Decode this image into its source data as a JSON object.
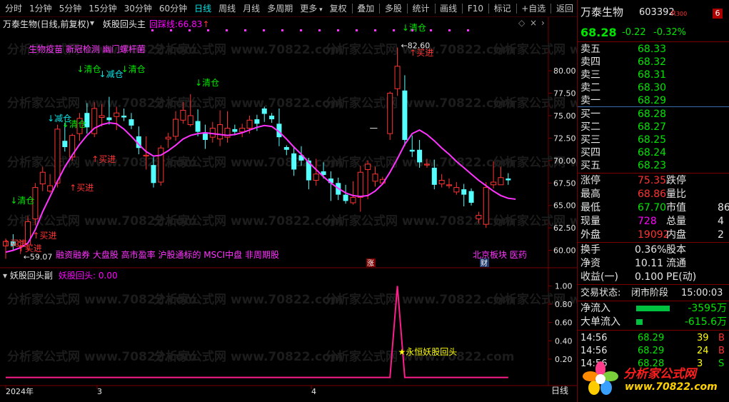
{
  "toolbar": {
    "left": [
      "分时",
      "1分钟",
      "5分钟",
      "15分钟",
      "30分钟",
      "60分钟",
      "日线",
      "周线",
      "月线",
      "多周期",
      "更多"
    ],
    "active": "日线",
    "right": [
      "复权",
      "叠加",
      "多股",
      "统计",
      "画线",
      "F10",
      "标记",
      "+自选",
      "返回"
    ]
  },
  "main_panel": {
    "title": "万泰生物(日线,前复权)",
    "formula": "妖股回头主",
    "indicator_label": "回踩线:",
    "indicator_value": "66.83",
    "indicator_arrow": "↑",
    "watermark": "分析家公式网 www.70822.com",
    "concepts_top": "生物疫苗 新冠检测 幽门螺杆菌",
    "concepts_bottom": "融资融券 大盘股 高市盈率 沪股通标的 MSCI中盘 非周期股",
    "concepts_right": "北京板块 医药",
    "price_low_label": "59.07",
    "price_high_label": "82.60",
    "zhang_badge": "涨",
    "cai_badge": "财",
    "signals": [
      {
        "text": "↓清仓",
        "color": "#00e600"
      },
      {
        "text": "↓减仓",
        "color": "#00e5e5"
      },
      {
        "text": "↓清仓",
        "color": "#00e600"
      },
      {
        "text": "↓减仓",
        "color": "#00e5e5"
      },
      {
        "text": "↓清仓",
        "color": "#00e600"
      },
      {
        "text": "↓清仓",
        "color": "#00e600"
      },
      {
        "text": "↓清仓",
        "color": "#00e600"
      },
      {
        "text": "↓清仓",
        "color": "#00e600"
      },
      {
        "text": "↑买进",
        "color": "#ff3232"
      },
      {
        "text": "↑买进",
        "color": "#ff3232"
      },
      {
        "text": "↑买进",
        "color": "#ff3232"
      },
      {
        "text": "↑买进",
        "color": "#ff3232"
      },
      {
        "text": "↑买进",
        "color": "#ff3232"
      },
      {
        "text": "↑买进",
        "color": "#ff3232"
      }
    ]
  },
  "sub_panel": {
    "title": "妖股回头副",
    "indicator_label": "妖股回头:",
    "indicator_value": "0.00",
    "annotation": "★永恒妖股回头"
  },
  "x_axis": {
    "labels": [
      "2024年",
      "3",
      "4"
    ],
    "period": "日线"
  },
  "chart_data": {
    "type": "candlestick",
    "main_y_ticks": [
      "80.00",
      "77.50",
      "75.00",
      "72.50",
      "70.00",
      "67.50",
      "65.00",
      "62.50",
      "60.00"
    ],
    "main_ylim": [
      58.3,
      84.7
    ],
    "sub_y_ticks": [
      "1.00",
      "0.80",
      "0.60",
      "0.40",
      "0.20"
    ],
    "sub_ylim": [
      -0.05,
      1.05
    ],
    "candles": [
      [
        60.5,
        61.3,
        59.07,
        61.0
      ],
      [
        61.0,
        61.8,
        60.0,
        60.5
      ],
      [
        60.5,
        61.2,
        59.6,
        61.0
      ],
      [
        60.6,
        63.8,
        60.0,
        63.2
      ],
      [
        63.5,
        67.5,
        62.8,
        67.0
      ],
      [
        67.4,
        69.3,
        66.6,
        68.7
      ],
      [
        66.6,
        68.5,
        66.4,
        67.2
      ],
      [
        67.5,
        74.0,
        67.0,
        73.5
      ],
      [
        72.2,
        74.2,
        71.0,
        71.5
      ],
      [
        70.4,
        73.0,
        70.0,
        72.8
      ],
      [
        73.0,
        75.3,
        72.2,
        74.7
      ],
      [
        75.3,
        76.4,
        73.0,
        73.7
      ],
      [
        73.0,
        76.5,
        72.6,
        75.8
      ],
      [
        74.8,
        76.3,
        73.8,
        75.0
      ],
      [
        74.8,
        77.1,
        74.0,
        74.5
      ],
      [
        74.9,
        76.0,
        73.4,
        75.3
      ],
      [
        75.0,
        75.8,
        74.4,
        74.8
      ],
      [
        74.6,
        75.3,
        73.5,
        73.9
      ],
      [
        72.7,
        73.8,
        70.7,
        71.4
      ],
      [
        70.5,
        72.7,
        69.0,
        70.6
      ],
      [
        69.5,
        70.4,
        67.0,
        67.5
      ],
      [
        67.6,
        71.7,
        67.2,
        71.4
      ],
      [
        72.4,
        73.1,
        71.4,
        72.6
      ],
      [
        72.7,
        75.5,
        72.2,
        74.6
      ],
      [
        74.5,
        76.5,
        74.1,
        75.6
      ],
      [
        74.0,
        77.4,
        73.8,
        75.0
      ],
      [
        74.4,
        75.7,
        72.7,
        73.2
      ],
      [
        73.0,
        74.0,
        71.3,
        72.3
      ],
      [
        72.6,
        74.3,
        72.0,
        73.6
      ],
      [
        72.4,
        75.6,
        71.6,
        74.0
      ],
      [
        72.6,
        75.5,
        72.0,
        73.6
      ],
      [
        73.5,
        74.0,
        72.8,
        73.2
      ],
      [
        73.2,
        74.1,
        72.6,
        73.6
      ],
      [
        73.6,
        75.0,
        73.0,
        74.5
      ],
      [
        74.6,
        75.1,
        73.3,
        74.1
      ],
      [
        75.8,
        76.0,
        74.3,
        75.2
      ],
      [
        75.0,
        75.3,
        74.2,
        74.6
      ],
      [
        74.1,
        75.8,
        71.6,
        72.6
      ],
      [
        71.5,
        71.7,
        70.6,
        71.2
      ],
      [
        70.8,
        71.6,
        68.3,
        69.0
      ],
      [
        70.6,
        71.6,
        69.4,
        70.0
      ],
      [
        70.0,
        70.3,
        66.8,
        67.8
      ],
      [
        67.8,
        70.2,
        67.2,
        68.5
      ],
      [
        68.8,
        69.8,
        68.0,
        68.4
      ],
      [
        68.0,
        68.8,
        65.5,
        67.5
      ],
      [
        67.5,
        68.1,
        65.6,
        66.2
      ],
      [
        66.2,
        67.3,
        65.2,
        65.5
      ],
      [
        65.3,
        67.7,
        65.1,
        65.9
      ],
      [
        65.9,
        69.4,
        64.3,
        68.7
      ],
      [
        69.0,
        70.0,
        65.7,
        69.6
      ],
      [
        67.7,
        69.3,
        67.1,
        68.5
      ],
      [
        67.5,
        68.2,
        67.3,
        67.9
      ],
      [
        73.0,
        77.7,
        72.3,
        77.5
      ],
      [
        78.0,
        82.6,
        77.2,
        80.5
      ],
      [
        77.8,
        79.5,
        71.6,
        72.3
      ],
      [
        71.2,
        72.8,
        70.4,
        71.0
      ],
      [
        71.2,
        72.3,
        69.2,
        69.8
      ],
      [
        69.5,
        70.2,
        69.2,
        69.6
      ],
      [
        69.2,
        70.1,
        66.8,
        67.3
      ],
      [
        67.4,
        68.5,
        67.0,
        67.8
      ],
      [
        67.2,
        68.0,
        66.9,
        67.3
      ],
      [
        66.5,
        67.6,
        66.2,
        67.0
      ],
      [
        66.8,
        67.4,
        64.9,
        66.2
      ],
      [
        66.6,
        66.9,
        65.0,
        65.3
      ],
      [
        63.5,
        64.3,
        63.0,
        63.9
      ],
      [
        62.9,
        67.6,
        62.5,
        67.0
      ],
      [
        67.3,
        69.9,
        66.9,
        67.6
      ],
      [
        67.3,
        69.3,
        67.4,
        68.1
      ],
      [
        68.0,
        68.6,
        67.3,
        67.8
      ]
    ],
    "support_line": [
      59.8,
      60.0,
      60.3,
      60.8,
      62.3,
      64.3,
      66.0,
      67.7,
      69.3,
      70.6,
      71.8,
      72.8,
      73.6,
      74.0,
      74.2,
      74.1,
      73.5,
      72.7,
      71.8,
      71.0,
      70.5,
      70.6,
      71.1,
      71.7,
      72.4,
      72.8,
      73.0,
      73.1,
      73.0,
      72.9,
      72.8,
      72.9,
      73.1,
      73.4,
      73.7,
      73.9,
      73.8,
      73.2,
      72.4,
      71.5,
      70.7,
      69.8,
      69.0,
      68.2,
      67.5,
      66.9,
      66.4,
      66.1,
      66.0,
      66.1,
      66.6,
      67.4,
      68.7,
      70.2,
      71.8,
      73.0,
      73.4,
      72.9,
      72.2,
      71.4,
      70.7,
      69.9,
      69.2,
      68.5,
      67.8,
      67.2,
      66.6,
      66.1,
      65.8,
      65.7,
      66.0,
      66.4,
      66.9
    ],
    "sub_series": [
      0,
      0,
      0,
      0,
      0,
      0,
      0,
      0,
      0,
      0,
      0,
      0,
      0,
      0,
      0,
      0,
      0,
      0,
      0,
      0,
      0,
      0,
      0,
      0,
      0,
      0,
      0,
      0,
      0,
      0,
      0,
      0,
      0,
      0,
      0,
      0,
      0,
      0,
      0,
      0,
      0,
      0,
      0,
      0,
      0,
      0,
      0,
      0,
      0,
      0,
      0,
      0,
      0,
      1,
      0,
      0,
      0,
      0,
      0,
      0,
      0,
      0,
      0,
      0,
      0,
      0,
      0,
      0,
      0
    ]
  },
  "quote": {
    "name": "万泰生物",
    "code": "603392",
    "badge": "R",
    "badge_num": "300",
    "price": "68.28",
    "change": "-0.22",
    "change_pct": "-0.32%",
    "asks": [
      {
        "label": "卖五",
        "price": "68.33"
      },
      {
        "label": "卖四",
        "price": "68.32"
      },
      {
        "label": "卖三",
        "price": "68.31"
      },
      {
        "label": "卖二",
        "price": "68.30"
      },
      {
        "label": "卖一",
        "price": "68.29"
      }
    ],
    "bids": [
      {
        "label": "买一",
        "price": "68.28"
      },
      {
        "label": "买二",
        "price": "68.27"
      },
      {
        "label": "买三",
        "price": "68.25"
      },
      {
        "label": "买四",
        "price": "68.24"
      },
      {
        "label": "买五",
        "price": "68.23"
      }
    ],
    "stats": [
      {
        "l1": "涨停",
        "v1": "75.35",
        "c1": "#ff3232",
        "l2": "跌停",
        "v2": ""
      },
      {
        "l1": "最高",
        "v1": "68.86",
        "c1": "#ff3232",
        "l2": "量比",
        "v2": ""
      },
      {
        "l1": "最低",
        "v1": "67.70",
        "c1": "#00e600",
        "l2": "市值",
        "v2": "86"
      },
      {
        "l1": "现量",
        "v1": "728",
        "c1": "#ff00ff",
        "l2": "总量",
        "v2": "4"
      },
      {
        "l1": "外盘",
        "v1": "19092",
        "c1": "#ff3232",
        "l2": "内盘",
        "v2": "2"
      }
    ],
    "stats2": [
      {
        "l1": "换手",
        "v1": "0.36%",
        "l2": "股本",
        "v2": ""
      },
      {
        "l1": "净资",
        "v1": "10.11",
        "l2": "流通",
        "v2": ""
      },
      {
        "l1": "收益(一)",
        "v1": "0.100",
        "l2": "PE(动)",
        "v2": ""
      }
    ],
    "trade_status_label": "交易状态:",
    "trade_status": "闭市阶段",
    "trade_time": "15:00:03",
    "flows": [
      {
        "label": "净流入",
        "value": "-3595万",
        "bar": 0.9
      },
      {
        "label": "大单流入",
        "value": "-615.6万",
        "bar": 0.17
      }
    ],
    "ticks": [
      {
        "time": "14:56",
        "price": "68.29",
        "vol": "39",
        "side": "B"
      },
      {
        "time": "14:56",
        "price": "68.29",
        "vol": "24",
        "side": "B"
      },
      {
        "time": "14:56",
        "price": "68.28",
        "vol": "3",
        "side": "S"
      }
    ],
    "logo_text": "分析家公式网",
    "logo_url": "www.70822.com"
  }
}
